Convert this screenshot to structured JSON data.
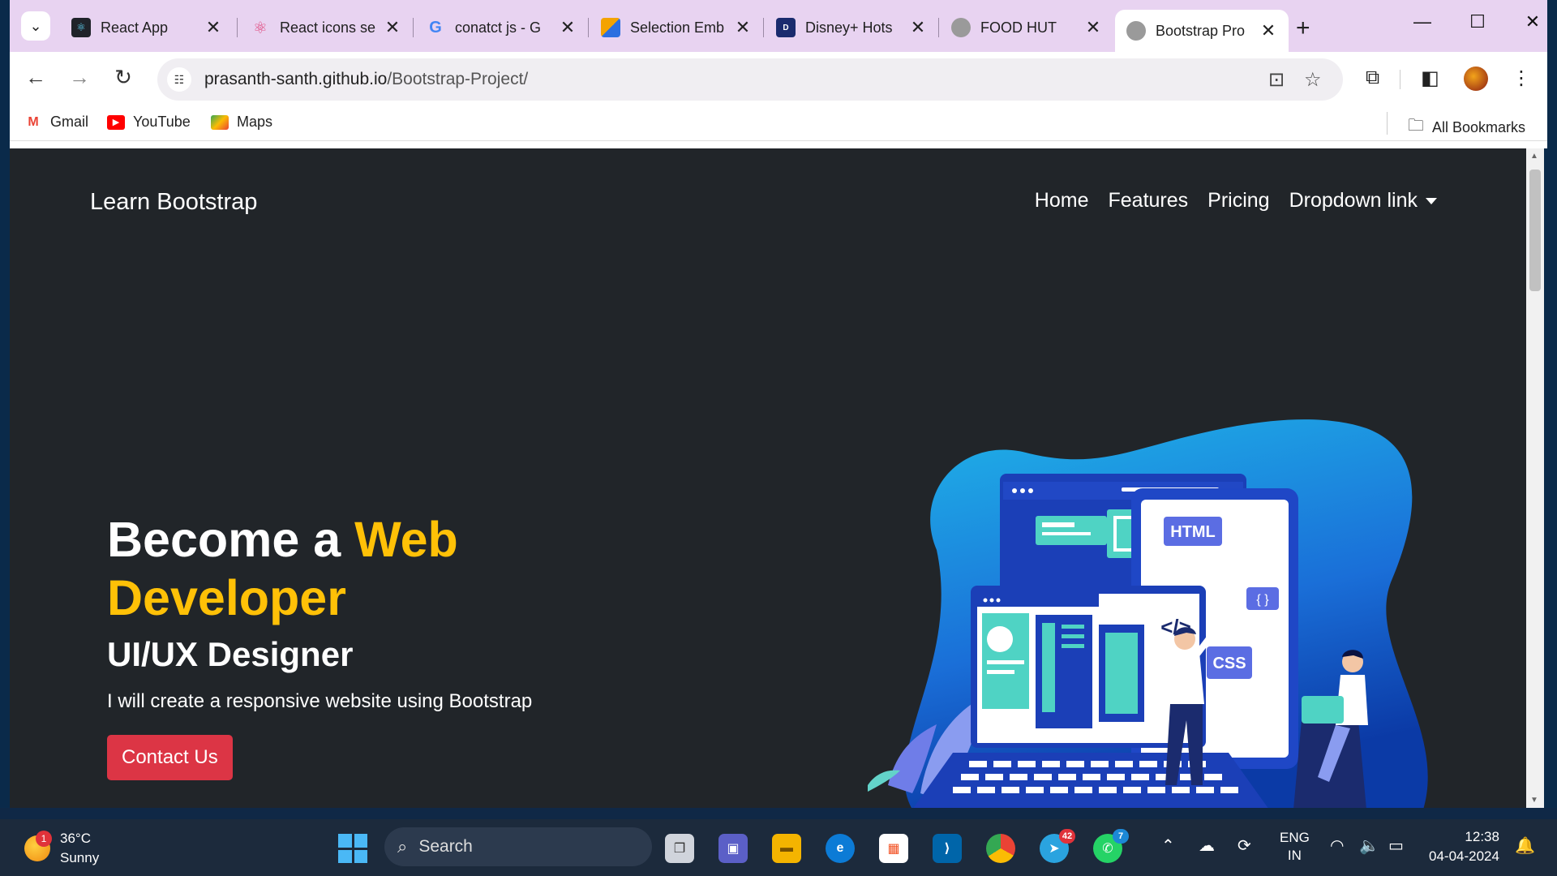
{
  "browser": {
    "tabs": [
      {
        "title": "React App",
        "icon": "react-icon",
        "color": "#61dafb"
      },
      {
        "title": "React icons se",
        "icon": "react-icon",
        "color": "#e0457b"
      },
      {
        "title": "conatct js - G",
        "icon": "google-icon",
        "color": "#4285f4"
      },
      {
        "title": "Selection Emb",
        "icon": "colorful-icon",
        "color": "#f4a300"
      },
      {
        "title": "Disney+ Hots",
        "icon": "disney-icon",
        "color": "#1a2b6e"
      },
      {
        "title": "FOOD HUT",
        "icon": "globe-icon",
        "color": "#888888"
      },
      {
        "title": "Bootstrap Pro",
        "icon": "globe-icon",
        "color": "#888888"
      }
    ],
    "url_host": "prasanth-santh.github.io",
    "url_path": "/Bootstrap-Project/",
    "bookmarks": [
      {
        "label": "Gmail",
        "icon": "gmail-icon"
      },
      {
        "label": "YouTube",
        "icon": "youtube-icon"
      },
      {
        "label": "Maps",
        "icon": "maps-icon"
      }
    ],
    "all_bookmarks": "All Bookmarks"
  },
  "site": {
    "brand": "Learn Bootstrap",
    "nav": {
      "home": "Home",
      "features": "Features",
      "pricing": "Pricing",
      "dropdown": "Dropdown link"
    },
    "hero": {
      "line1_white": "Become a ",
      "line1_yellow": "Web Developer",
      "subtitle": "UI/UX Designer",
      "text": "I will create a responsive website using Bootstrap",
      "button": "Contact Us"
    },
    "illustration_labels": {
      "html": "HTML",
      "css": "CSS",
      "braces": "{ }",
      "code": "</>"
    }
  },
  "taskbar": {
    "temperature": "36°C",
    "condition": "Sunny",
    "weather_badge": "1",
    "search": "Search",
    "telegram_badge": "42",
    "whatsapp_badge": "7",
    "lang1": "ENG",
    "lang2": "IN",
    "time": "12:38",
    "date": "04-04-2024"
  },
  "colors": {
    "accent_yellow": "#ffc107",
    "button_red": "#dc3545",
    "page_bg": "#212529",
    "tabstrip": "#e8d3f1"
  }
}
